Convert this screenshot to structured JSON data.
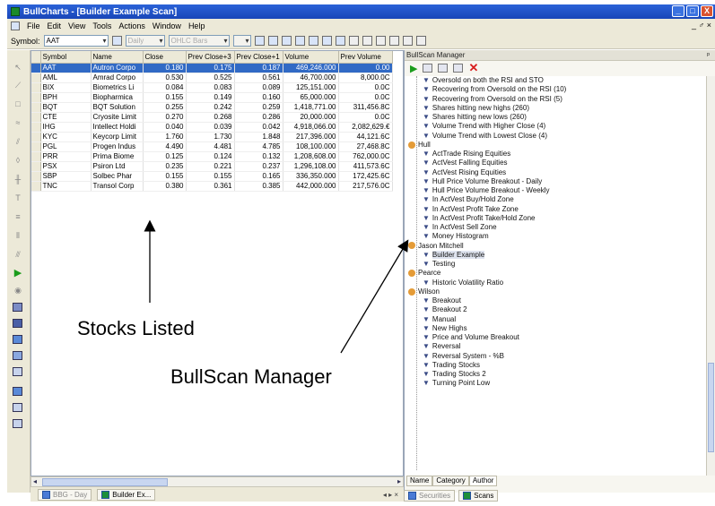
{
  "window": {
    "title": "BullCharts - [Builder Example Scan]",
    "controls": [
      "_",
      "□",
      "X"
    ],
    "mdi_controls": "_ ♂ ×"
  },
  "menu": [
    "File",
    "Edit",
    "View",
    "Tools",
    "Actions",
    "Window",
    "Help"
  ],
  "toolbar": {
    "symbol_label": "Symbol:",
    "symbol_value": "AAT",
    "period_value": "Daily",
    "charttype_value": "OHLC Bars"
  },
  "grid": {
    "columns": [
      "Symbol",
      "Name",
      "Close",
      "Prev Close+3",
      "Prev Close+1",
      "Volume",
      "Prev Volume"
    ],
    "rows": [
      [
        "AAT",
        "Autron Corpo",
        "0.180",
        "0.175",
        "0.187",
        "469,246.000",
        "0.00"
      ],
      [
        "AML",
        "Amrad Corpo",
        "0.530",
        "0.525",
        "0.561",
        "46,700.000",
        "8,000.0C"
      ],
      [
        "BIX",
        "Biometrics Li",
        "0.084",
        "0.083",
        "0.089",
        "125,151.000",
        "0.0C"
      ],
      [
        "BPH",
        "Biopharmica",
        "0.155",
        "0.149",
        "0.160",
        "65,000.000",
        "0.0C"
      ],
      [
        "BQT",
        "BQT Solution",
        "0.255",
        "0.242",
        "0.259",
        "1,418,771.00",
        "311,456.8C"
      ],
      [
        "CTE",
        "Cryosite Limit",
        "0.270",
        "0.268",
        "0.286",
        "20,000.000",
        "0.0C"
      ],
      [
        "IHG",
        "Intellect Holdi",
        "0.040",
        "0.039",
        "0.042",
        "4,918,066.00",
        "2,082,629.€"
      ],
      [
        "KYC",
        "Keycorp Limit",
        "1.760",
        "1.730",
        "1.848",
        "217,396.000",
        "44,121.6C"
      ],
      [
        "PGL",
        "Progen Indus",
        "4.490",
        "4.481",
        "4.785",
        "108,100.000",
        "27,468.8C"
      ],
      [
        "PRR",
        "Prima Biome",
        "0.125",
        "0.124",
        "0.132",
        "1,208,608.00",
        "762,000.0C"
      ],
      [
        "PSX",
        "Psiron Ltd",
        "0.235",
        "0.221",
        "0.237",
        "1,296,108.00",
        "411,573.6C"
      ],
      [
        "SBP",
        "Solbec Phar",
        "0.155",
        "0.155",
        "0.165",
        "336,350.000",
        "172,425.6C"
      ],
      [
        "TNC",
        "Transol Corp",
        "0.380",
        "0.361",
        "0.385",
        "442,000.000",
        "217,576.0C"
      ]
    ],
    "selected_row": 0
  },
  "bottom_tabs": {
    "tab1": "BBG - Day",
    "tab2": "Builder Ex...",
    "nav": "◂ ▸ ×"
  },
  "panel": {
    "title": "BullScan Manager",
    "pin": "ᵖ",
    "tree": [
      {
        "kind": "scan",
        "label": "Oversold on both the RSI and STO"
      },
      {
        "kind": "scan",
        "label": "Recovering from Oversold on the RSI (10)"
      },
      {
        "kind": "scan",
        "label": "Recovering from Oversold on the RSI (5)"
      },
      {
        "kind": "scan",
        "label": "Shares hitting new highs (260)"
      },
      {
        "kind": "scan",
        "label": "Shares hitting new lows (260)"
      },
      {
        "kind": "scan",
        "label": "Volume Trend with Higher Close (4)"
      },
      {
        "kind": "scan",
        "label": "Volume Trend with Lowest Close (4)"
      },
      {
        "kind": "author",
        "label": "Hull"
      },
      {
        "kind": "scan",
        "label": "ActTrade Rising Equities"
      },
      {
        "kind": "scan",
        "label": "ActVest Falling Equities"
      },
      {
        "kind": "scan",
        "label": "ActVest Rising Equities"
      },
      {
        "kind": "scan",
        "label": "Hull Price Volume Breakout - Daily"
      },
      {
        "kind": "scan",
        "label": "Hull Price Volume Breakout - Weekly"
      },
      {
        "kind": "scan",
        "label": "In ActVest Buy/Hold Zone"
      },
      {
        "kind": "scan",
        "label": "In ActVest Profit Take Zone"
      },
      {
        "kind": "scan",
        "label": "In ActVest Profit Take/Hold Zone"
      },
      {
        "kind": "scan",
        "label": "In ActVest Sell Zone"
      },
      {
        "kind": "scan",
        "label": "Money Histogram"
      },
      {
        "kind": "author",
        "label": "Jason Mitchell"
      },
      {
        "kind": "scan",
        "label": "Builder Example",
        "selected": true
      },
      {
        "kind": "scan",
        "label": "Testing"
      },
      {
        "kind": "author",
        "label": "Pearce"
      },
      {
        "kind": "scan",
        "label": "Historic Volatility Ratio"
      },
      {
        "kind": "author",
        "label": "Wilson"
      },
      {
        "kind": "scan",
        "label": "Breakout"
      },
      {
        "kind": "scan",
        "label": "Breakout 2"
      },
      {
        "kind": "scan",
        "label": "Manual"
      },
      {
        "kind": "scan",
        "label": "New Highs"
      },
      {
        "kind": "scan",
        "label": "Price and Volume Breakout"
      },
      {
        "kind": "scan",
        "label": "Reversal"
      },
      {
        "kind": "scan",
        "label": "Reversal System - %B"
      },
      {
        "kind": "scan",
        "label": "Trading Stocks"
      },
      {
        "kind": "scan",
        "label": "Trading Stocks 2"
      },
      {
        "kind": "scan",
        "label": "Turning Point Low"
      }
    ],
    "sort_tabs": [
      "Name",
      "Category",
      "Author"
    ],
    "active_sort": "Author",
    "bottom_tabs": [
      "Securities",
      "Scans"
    ]
  },
  "annotations": {
    "stocks_listed": "Stocks Listed",
    "bullscan_manager": "BullScan Manager"
  }
}
